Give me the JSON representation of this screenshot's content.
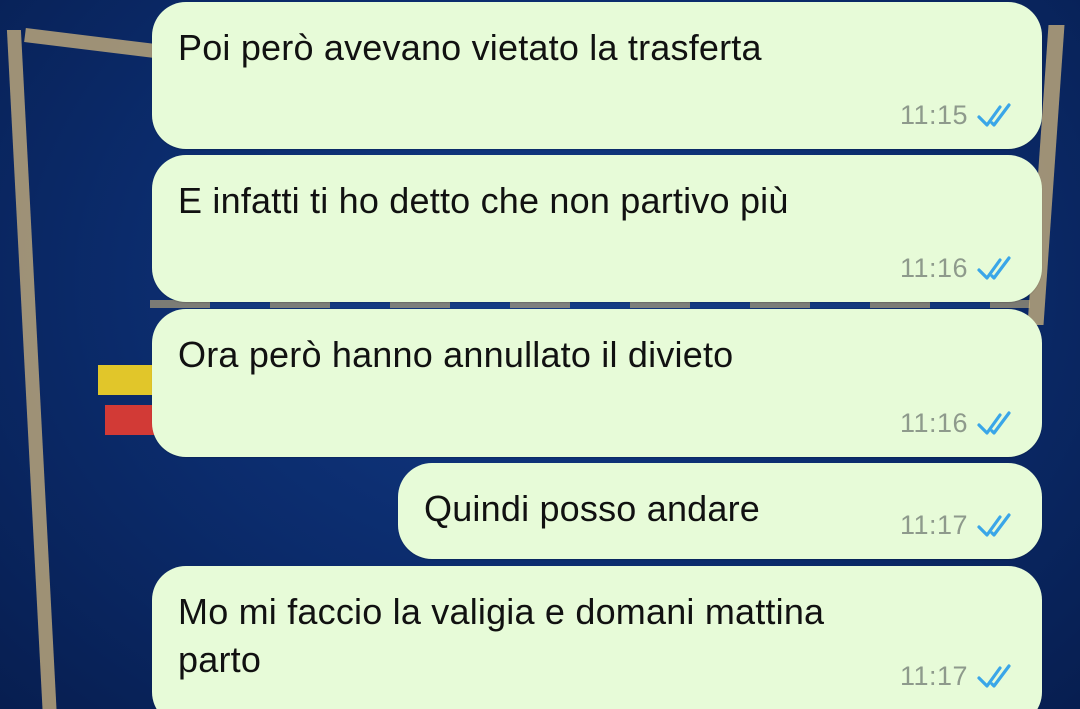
{
  "colors": {
    "bubble_background": "#e7fbd8",
    "wallpaper_background": "#0b2b6b",
    "read_tick": "#3aa6e8",
    "timestamp": "#8e9a8c"
  },
  "messages": [
    {
      "text": "Poi però avevano vietato la trasferta",
      "time": "11:15",
      "status_icon": "double-check-read-icon"
    },
    {
      "text": "E infatti ti ho detto che non partivo più",
      "time": "11:16",
      "status_icon": "double-check-read-icon"
    },
    {
      "text": "Ora però hanno annullato il divieto",
      "time": "11:16",
      "status_icon": "double-check-read-icon"
    },
    {
      "text": "Quindi posso andare",
      "time": "11:17",
      "status_icon": "double-check-read-icon"
    },
    {
      "text": "Mo mi faccio la valigia e domani mattina\nparto",
      "time": "11:17",
      "status_icon": "double-check-read-icon"
    }
  ]
}
